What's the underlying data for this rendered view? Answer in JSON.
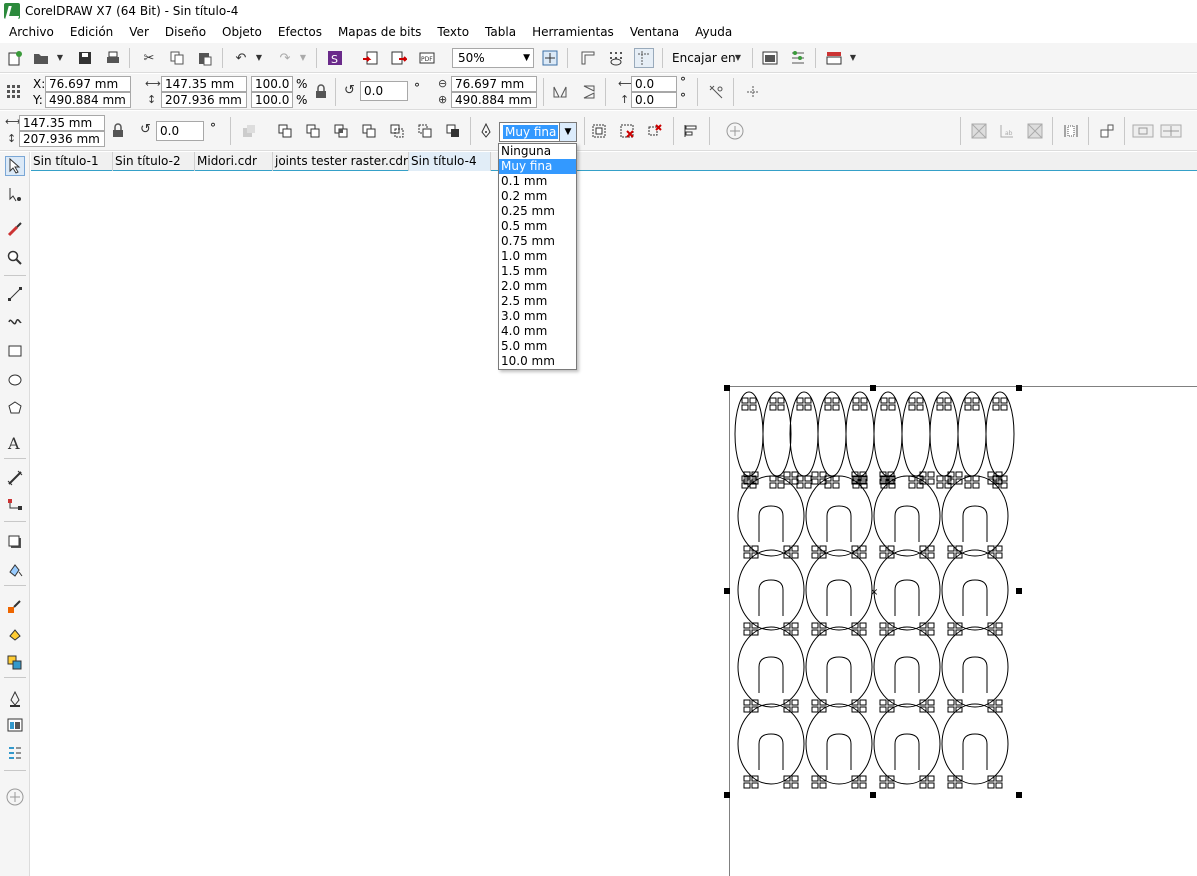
{
  "window": {
    "title": "CorelDRAW X7 (64 Bit) - Sin título-4",
    "logo_icon": "coreldraw-logo-icon"
  },
  "menu": [
    "Archivo",
    "Edición",
    "Ver",
    "Diseño",
    "Objeto",
    "Efectos",
    "Mapas de bits",
    "Texto",
    "Tabla",
    "Herramientas",
    "Ventana",
    "Ayuda"
  ],
  "standard_toolbar": {
    "zoom": "50%",
    "fit_label": "Encajar en",
    "icons": [
      "new-icon",
      "open-icon",
      "save-icon",
      "print-icon",
      "cut-icon",
      "copy-icon",
      "paste-icon",
      "undo-icon",
      "redo-icon",
      "corel-connect-icon",
      "import-icon",
      "export-icon",
      "publish-pdf-icon",
      "zoom-fit-icon",
      "rulers-icon",
      "grid-icon",
      "guidelines-icon",
      "launch-icon",
      "options-icon",
      "application-launcher-icon"
    ]
  },
  "property_bar": {
    "x_label": "X:",
    "x_value": "76.697 mm",
    "y_label": "Y:",
    "y_value": "490.884 mm",
    "width_value": "147.35 mm",
    "height_value": "207.936 mm",
    "scale_x": "100.0",
    "scale_y": "100.0",
    "percent": "%",
    "rotation": "0.0",
    "degree": "°",
    "center_x": "76.697 mm",
    "center_y": "490.884 mm",
    "skew_h": "0.0",
    "skew_v": "0.0"
  },
  "object_bar": {
    "width_value": "147.35 mm",
    "height_value": "207.936 mm",
    "rotation": "0.0",
    "degree": "°",
    "outline_width": "Muy fina"
  },
  "outline_dropdown": {
    "options": [
      "Ninguna",
      "Muy fina",
      "0.1 mm",
      "0.2 mm",
      "0.25 mm",
      "0.5 mm",
      "0.75 mm",
      "1.0 mm",
      "1.5 mm",
      "2.0 mm",
      "2.5 mm",
      "3.0 mm",
      "4.0 mm",
      "5.0 mm",
      "10.0 mm"
    ],
    "selected": "Muy fina"
  },
  "doc_tabs": [
    "Sin título-1",
    "Sin título-2",
    "Midori.cdr",
    "joints tester raster.cdr",
    "Sin título-4"
  ],
  "active_tab": "Sin título-4",
  "toolbox": [
    "pick-tool-icon",
    "shape-tool-icon",
    "artistic-media-icon",
    "zoom-tool-icon",
    "freehand-tool-icon",
    "smart-drawing-icon",
    "rectangle-tool-icon",
    "ellipse-tool-icon",
    "polygon-tool-icon",
    "text-tool-icon",
    "dimension-tool-icon",
    "connector-tool-icon",
    "drop-shadow-icon",
    "transparency-icon",
    "eyedropper-icon",
    "interactive-fill-icon",
    "smart-fill-icon",
    "outline-pen-icon",
    "color-dialog-icon",
    "object-properties-icon",
    "add-tool-icon"
  ],
  "colors": {
    "selection_blue": "#3399ff",
    "tab_accent": "#35a0c8",
    "toolbar_bg": "#f5f5f5"
  }
}
